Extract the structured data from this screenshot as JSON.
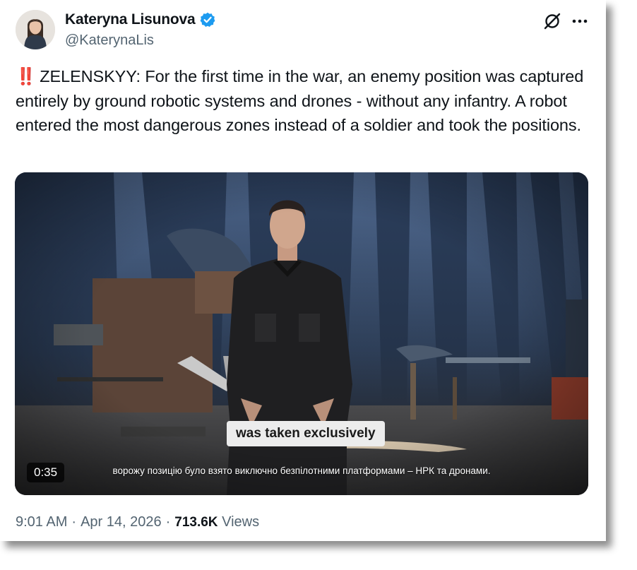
{
  "author": {
    "display_name": "Kateryna Lisunova",
    "handle": "@KaterynaLis",
    "verified": true,
    "avatar": "profile-photo"
  },
  "icons": {
    "verified": "verified-badge-icon",
    "grok": "grok-icon",
    "more": "more-options-icon",
    "emoji": "double-exclamation-emoji"
  },
  "tweet": {
    "emoji": "‼️",
    "text": "ZELENSKYY: For the first time in the war, an enemy position was captured entirely by ground robotic systems and drones - without any infantry. A robot entered the most dangerous zones instead of a soldier and took the positions."
  },
  "media": {
    "type": "video",
    "duration": "0:35",
    "caption_en": "was taken exclusively",
    "caption_ua": "ворожу позицію було взято виключно безпілотними платформами – НРК та дронами."
  },
  "meta": {
    "time": "9:01 AM",
    "separator": "·",
    "date": "Apr 14, 2026",
    "views_count": "713.6K",
    "views_label": "Views"
  },
  "colors": {
    "text_primary": "#0f1419",
    "text_secondary": "#536471",
    "verified_blue": "#1d9bf0",
    "emoji_red": "#e0243a"
  }
}
